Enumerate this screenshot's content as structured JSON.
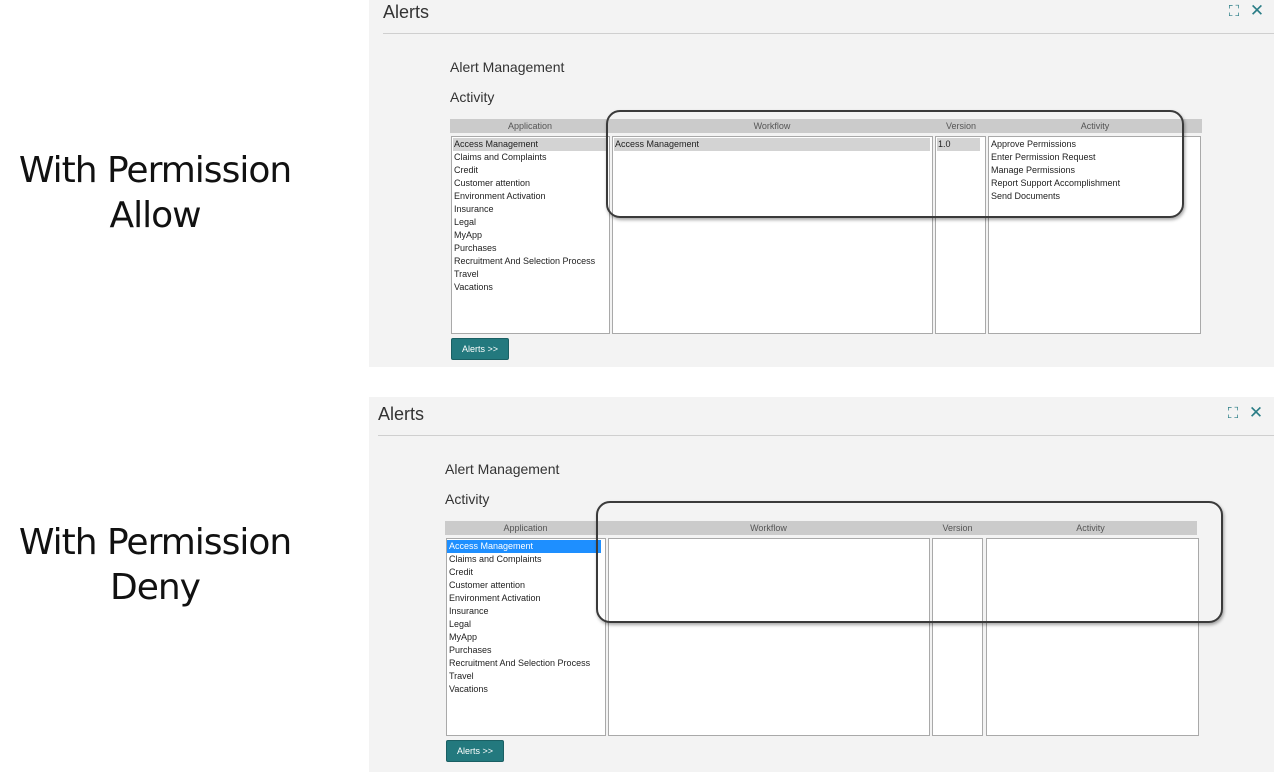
{
  "labels": {
    "allow": [
      "With Permission",
      "Allow"
    ],
    "deny": [
      "With Permission",
      "Deny"
    ]
  },
  "panels": {
    "allow": {
      "title": "Alerts",
      "section_title": "Alert Management",
      "subsection_title": "Activity",
      "columns": {
        "application": "Application",
        "workflow": "Workflow",
        "version": "Version",
        "activity": "Activity"
      },
      "applications": [
        "Access Management",
        "Claims and Complaints",
        "Credit",
        "Customer attention",
        "Environment Activation",
        "Insurance",
        "Legal",
        "MyApp",
        "Purchases",
        "Recruitment And Selection Process",
        "Travel",
        "Vacations"
      ],
      "workflows": [
        "Access Management"
      ],
      "versions": [
        "1.0"
      ],
      "activities": [
        "Approve Permissions",
        "Enter Permission Request",
        "Manage Permissions",
        "Report Support Accomplishment",
        "Send Documents"
      ],
      "button_label": "Alerts >>"
    },
    "deny": {
      "title": "Alerts",
      "section_title": "Alert Management",
      "subsection_title": "Activity",
      "columns": {
        "application": "Application",
        "workflow": "Workflow",
        "version": "Version",
        "activity": "Activity"
      },
      "applications": [
        "Access Management",
        "Claims and Complaints",
        "Credit",
        "Customer attention",
        "Environment Activation",
        "Insurance",
        "Legal",
        "MyApp",
        "Purchases",
        "Recruitment And Selection Process",
        "Travel",
        "Vacations"
      ],
      "workflows": [],
      "versions": [],
      "activities": [],
      "button_label": "Alerts >>"
    }
  },
  "icons": {
    "maximize": "expand-icon",
    "close": "close-icon"
  },
  "colors": {
    "accent": "#23797e",
    "selection_blue": "#1e8fff",
    "selection_gray": "#d3d3d3"
  }
}
